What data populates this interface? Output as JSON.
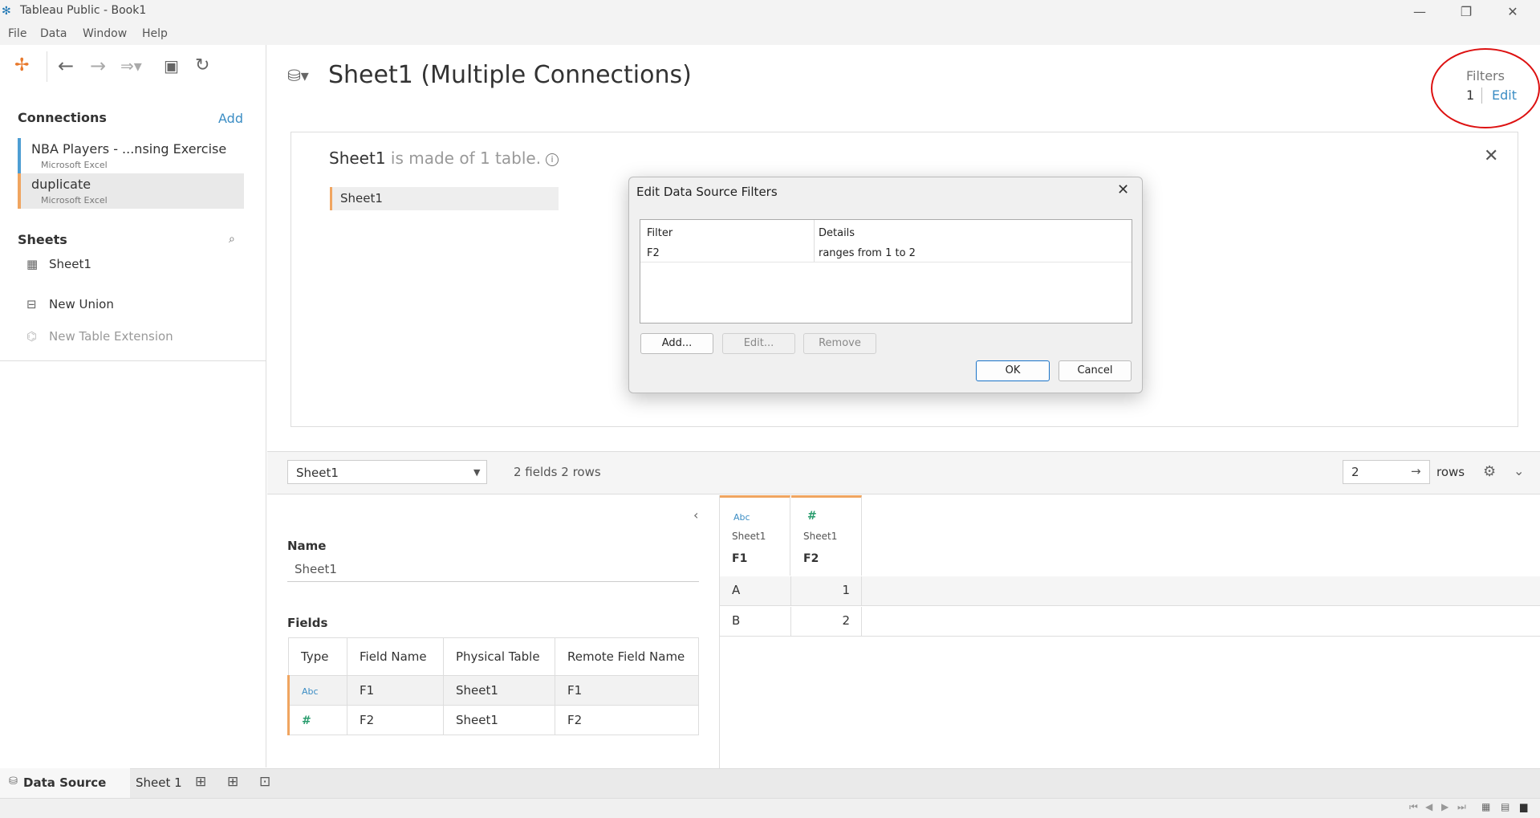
{
  "window": {
    "title": "Tableau Public - Book1",
    "minimize": "—",
    "restore": "❐",
    "close": "✕"
  },
  "menu": [
    "File",
    "Data",
    "Window",
    "Help"
  ],
  "left": {
    "connections_title": "Connections",
    "add_label": "Add",
    "connections": [
      {
        "name": "NBA Players - ...nsing Exercise",
        "type": "Microsoft Excel",
        "color": "#4e9ed3"
      },
      {
        "name": "duplicate",
        "type": "Microsoft Excel",
        "color": "#f0a560"
      }
    ],
    "sheets_title": "Sheets",
    "sheets": [
      "Sheet1"
    ],
    "new_union": "New Union",
    "new_table_extension": "New Table Extension"
  },
  "main": {
    "title": "Sheet1 (Multiple Connections)",
    "filters_label": "Filters",
    "filters_count": "1",
    "filters_edit": "Edit",
    "canvas_table_name": "Sheet1",
    "canvas_description": " is made of 1 table.",
    "canvas_table_pill": "Sheet1"
  },
  "grid_toolbar": {
    "table_select": "Sheet1",
    "fields_rows": "2 fields 2 rows",
    "rows_value": "2",
    "rows_label": "rows"
  },
  "metadata": {
    "name_label": "Name",
    "name_value": "Sheet1",
    "fields_label": "Fields",
    "columns": [
      "Type",
      "Field Name",
      "Physical Table",
      "Remote Field Name"
    ],
    "rows": [
      {
        "type": "Abc",
        "field": "F1",
        "table": "Sheet1",
        "remote": "F1"
      },
      {
        "type": "#",
        "field": "F2",
        "table": "Sheet1",
        "remote": "F2"
      }
    ]
  },
  "data_grid": {
    "columns": [
      {
        "type": "Abc",
        "source": "Sheet1",
        "name": "F1"
      },
      {
        "type": "#",
        "source": "Sheet1",
        "name": "F2"
      }
    ],
    "rows": [
      [
        "A",
        "1"
      ],
      [
        "B",
        "2"
      ]
    ]
  },
  "dialog": {
    "title": "Edit Data Source Filters",
    "col_filter": "Filter",
    "col_details": "Details",
    "filter_name": "F2",
    "filter_details": "ranges from 1 to 2",
    "add_btn": "Add...",
    "edit_btn": "Edit...",
    "remove_btn": "Remove",
    "ok_btn": "OK",
    "cancel_btn": "Cancel"
  },
  "bottom": {
    "data_source_tab": "Data Source",
    "sheet_tab": "Sheet 1"
  },
  "colors": {
    "accent_blue": "#3b8dc4",
    "accent_orange": "#f0a560",
    "annotation_red": "#dd1111"
  }
}
